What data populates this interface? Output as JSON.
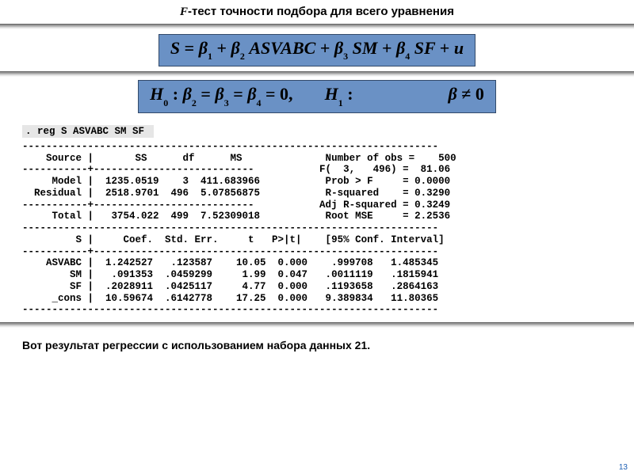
{
  "title_prefix_F": "F",
  "title_rest": "-тест точности подбора для всего уравнения",
  "equation_display": "S = β1 + β2 ASVABC + β3 SM + β4 SF + u",
  "hypotheses_display": "H0 : β2 = β3 = β4 = 0,    H1 :          β ≠ 0",
  "cmd": ". reg S ASVABC SM SF ",
  "reg_output": "----------------------------------------------------------------------\n    Source |       SS      df      MS              Number of obs =    500\n-----------+---------------------------           F(  3,   496) =  81.06\n     Model |  1235.0519    3  411.683966           Prob > F     = 0.0000\n  Residual |  2518.9701  496  5.07856875           R-squared    = 0.3290\n-----------+---------------------------           Adj R-squared = 0.3249\n     Total |   3754.022  499  7.52309018           Root MSE     = 2.2536\n----------------------------------------------------------------------\n         S |     Coef.  Std. Err.     t   P>|t|    [95% Conf. Interval]\n-----------+----------------------------------------------------------\n    ASVABC |  1.242527   .123587    10.05  0.000    .999708   1.485345\n        SM |   .091353  .0459299     1.99  0.047   .0011119   .1815941\n        SF |  .2028911  .0425117     4.77  0.000   .1193658   .2864163\n     _cons |  10.59674  .6142778    17.25  0.000   9.389834   11.80365\n----------------------------------------------------------------------",
  "caption": "Вот результат регрессии с использованием набора данных 21.",
  "slide_number": "13",
  "chart_data": {
    "type": "table",
    "command": ". reg S ASVABC SM SF",
    "anova": {
      "headers": [
        "Source",
        "SS",
        "df",
        "MS"
      ],
      "rows": [
        {
          "Source": "Model",
          "SS": 1235.0519,
          "df": 3,
          "MS": 411.683966
        },
        {
          "Source": "Residual",
          "SS": 2518.9701,
          "df": 496,
          "MS": 5.07856875
        },
        {
          "Source": "Total",
          "SS": 3754.022,
          "df": 499,
          "MS": 7.52309018
        }
      ]
    },
    "stats": {
      "Number of obs": 500,
      "F(3, 496)": 81.06,
      "Prob > F": 0.0,
      "R-squared": 0.329,
      "Adj R-squared": 0.3249,
      "Root MSE": 2.2536
    },
    "coefficients": {
      "headers": [
        "",
        "Coef.",
        "Std. Err.",
        "t",
        "P>|t|",
        "95% CI low",
        "95% CI high"
      ],
      "rows": [
        {
          "var": "ASVABC",
          "Coef": 1.242527,
          "StdErr": 0.123587,
          "t": 10.05,
          "P": 0.0,
          "ci_low": 0.999708,
          "ci_high": 1.485345
        },
        {
          "var": "SM",
          "Coef": 0.091353,
          "StdErr": 0.0459299,
          "t": 1.99,
          "P": 0.047,
          "ci_low": 0.0011119,
          "ci_high": 0.1815941
        },
        {
          "var": "SF",
          "Coef": 0.2028911,
          "StdErr": 0.0425117,
          "t": 4.77,
          "P": 0.0,
          "ci_low": 0.1193658,
          "ci_high": 0.2864163
        },
        {
          "var": "_cons",
          "Coef": 10.59674,
          "StdErr": 0.6142778,
          "t": 17.25,
          "P": 0.0,
          "ci_low": 9.389834,
          "ci_high": 11.80365
        }
      ]
    }
  }
}
